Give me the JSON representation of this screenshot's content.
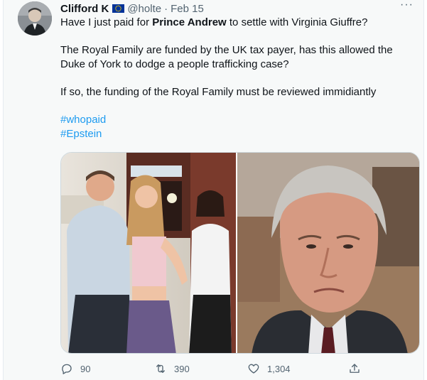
{
  "tweet": {
    "author_name": "Clifford K",
    "author_handle": "@holte",
    "separator": "·",
    "date": "Feb 15",
    "more_label": "···",
    "text": {
      "line1_prefix": "Have I just paid for ",
      "line1_bold": "Prince Andrew",
      "line1_suffix": " to settle with Virginia Giuffre?",
      "para2": "The Royal Family are funded by the UK tax payer, has this allowed the Duke of York to dodge a people trafficking case?",
      "para3": "If so, the funding of the Royal Family must be reviewed immidiantly",
      "hashtags": [
        "#whopaid",
        "#Epstein"
      ]
    },
    "media": [
      {
        "name": "group-photo",
        "alt": ""
      },
      {
        "name": "portrait-photo",
        "alt": ""
      }
    ],
    "actions": {
      "reply_count": "90",
      "retweet_count": "390",
      "like_count": "1,304",
      "icons": [
        "reply-icon",
        "retweet-icon",
        "like-icon",
        "share-icon"
      ]
    },
    "colors": {
      "accent": "#1d9bf0",
      "text": "#0f1419",
      "muted": "#536471",
      "background": "#f7f9f9",
      "flag_blue": "#003399",
      "flag_star": "#ffcc00"
    }
  }
}
